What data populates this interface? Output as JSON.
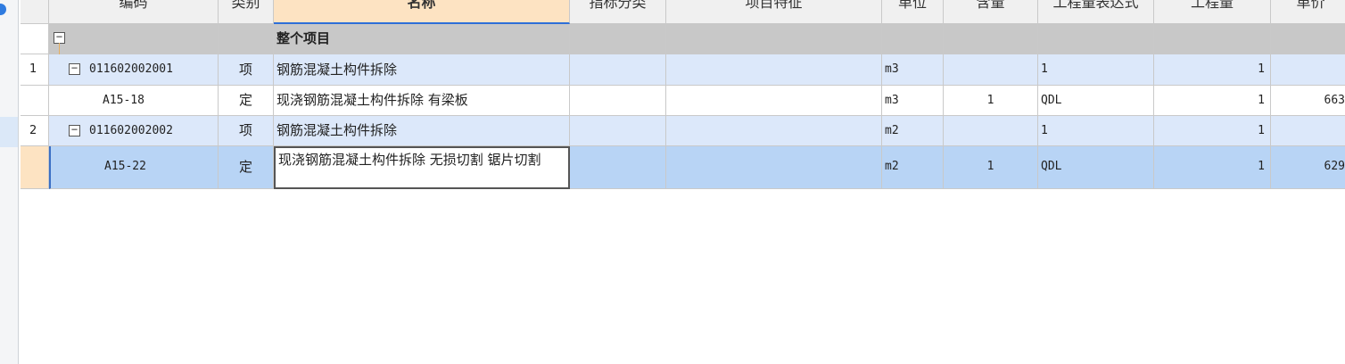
{
  "columns": [
    "编码",
    "类别",
    "名称",
    "指标分类",
    "项目特征",
    "单位",
    "含量",
    "工程量表达式",
    "工程量",
    "单价"
  ],
  "root": {
    "label": "整个项目",
    "toggle": "−"
  },
  "rows": [
    {
      "num": "1",
      "code": "011602002001",
      "type": "项",
      "name": "钢筋混凝土构件拆除",
      "unit": "m3",
      "content": "",
      "expr": "1",
      "qty": "1",
      "price": ""
    },
    {
      "num": "",
      "code": "A15-18",
      "type": "定",
      "name": "现浇钢筋混凝土构件拆除 有梁板",
      "unit": "m3",
      "content": "1",
      "expr": "QDL",
      "qty": "1",
      "price": "663"
    },
    {
      "num": "2",
      "code": "011602002002",
      "type": "项",
      "name": "钢筋混凝土构件拆除",
      "unit": "m2",
      "content": "",
      "expr": "1",
      "qty": "1",
      "price": ""
    },
    {
      "num": "",
      "code": "A15-22",
      "type": "定",
      "name": "现浇钢筋混凝土构件拆除 无损切割 锯片切割",
      "unit": "m2",
      "content": "1",
      "expr": "QDL",
      "qty": "1",
      "price": "629"
    }
  ],
  "colors": {
    "header_bg": "#f0f0f0",
    "root_bg": "#c8c8c8",
    "item_bg": "#dce8fa",
    "selected_bg": "#b8d4f5",
    "active_header": "#fde3c2"
  }
}
